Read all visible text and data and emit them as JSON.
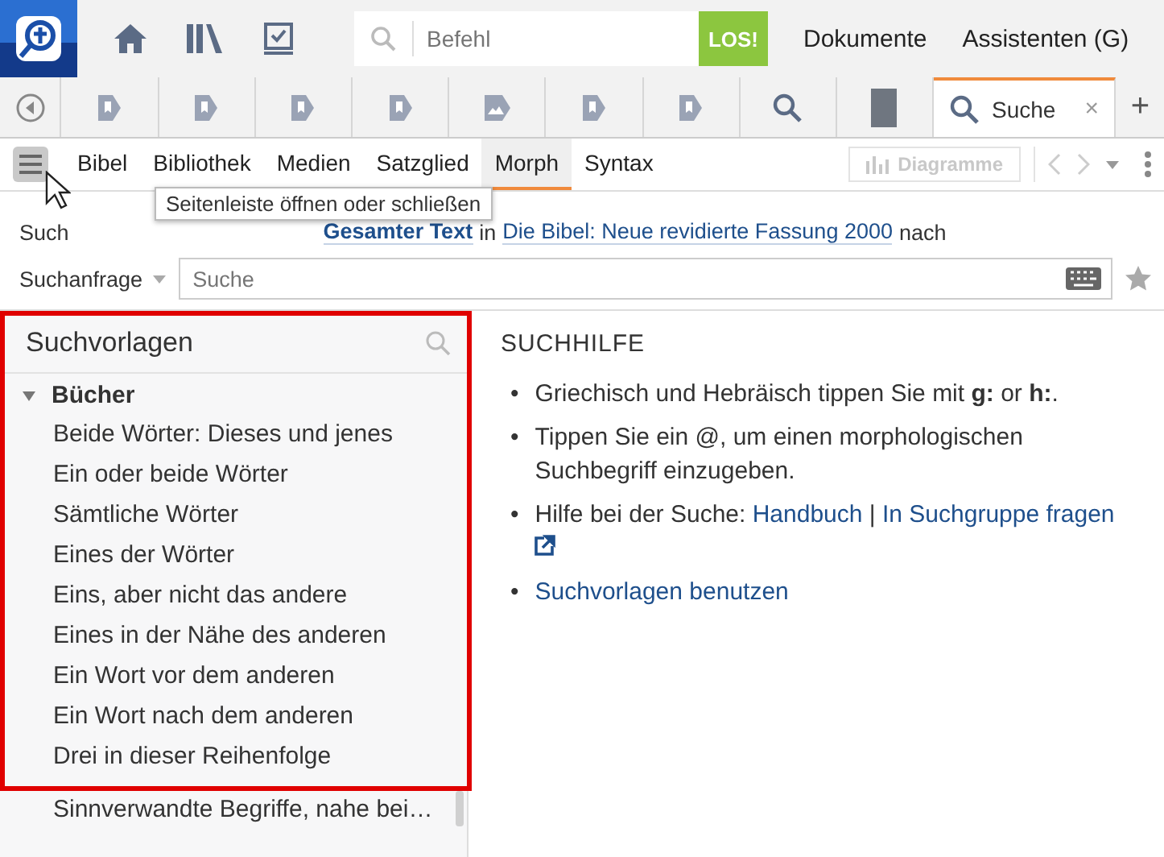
{
  "top_bar": {
    "command": {
      "placeholder": "Befehl"
    },
    "go_button": "LOS!",
    "menus": [
      "Dokumente",
      "Assistenten (G)"
    ]
  },
  "tabs": [
    {
      "kind": "doc",
      "selected": false
    },
    {
      "kind": "doc",
      "selected": false
    },
    {
      "kind": "doc",
      "selected": false
    },
    {
      "kind": "doc",
      "selected": false
    },
    {
      "kind": "image",
      "selected": false
    },
    {
      "kind": "doc",
      "selected": false
    },
    {
      "kind": "doc",
      "selected": false
    },
    {
      "kind": "search",
      "selected": false
    },
    {
      "kind": "book",
      "selected": false
    },
    {
      "kind": "search",
      "label": "Suche",
      "close": "×",
      "selected": true
    }
  ],
  "new_tab": "+",
  "toolbar": {
    "sidebar_toggle": {
      "pressed": true
    },
    "tabs": [
      {
        "label": "Bibel",
        "selected": false
      },
      {
        "label": "Bibliothek",
        "selected": false
      },
      {
        "label": "Medien",
        "selected": false
      },
      {
        "label": "Satzglied",
        "selected": false
      },
      {
        "label": "Morph",
        "selected": true
      },
      {
        "label": "Syntax",
        "selected": false
      }
    ],
    "charts_button": {
      "label": "Diagramme",
      "disabled": true
    }
  },
  "tooltip": "Seitenleiste öffnen oder schließen",
  "search_line": [
    {
      "kind": "text",
      "text": "Such"
    },
    {
      "kind": "link",
      "text": "Gesamter Text",
      "bold": true
    },
    {
      "kind": "text",
      "text": "in"
    },
    {
      "kind": "link",
      "text": "Die Bibel: Neue revidierte Fassung 2000",
      "bold": false
    },
    {
      "kind": "text",
      "text": "nach"
    }
  ],
  "query": {
    "type_label": "Suchanfrage",
    "placeholder": "Suche"
  },
  "sidebar": {
    "title": "Suchvorlagen",
    "highlighted": true,
    "tree": [
      {
        "label": "Bücher",
        "expanded": true,
        "children": [
          {
            "label": "Beide Wörter: Dieses und jenes"
          },
          {
            "label": "Ein oder beide Wörter"
          },
          {
            "label": "Sämtliche Wörter"
          },
          {
            "label": "Eines der Wörter"
          },
          {
            "label": "Eins, aber nicht das andere"
          },
          {
            "label": "Eines in der Nähe des anderen"
          },
          {
            "label": "Ein Wort vor dem anderen"
          },
          {
            "label": "Ein Wort nach dem anderen"
          },
          {
            "label": "Drei in dieser Reihenfolge"
          },
          {
            "label": "Sinnverwandte Begriffe, nahe bei…"
          }
        ]
      }
    ]
  },
  "help": {
    "title": "SUCHHILFE",
    "items": [
      {
        "kind": "text",
        "bullet": "•",
        "text": "Griechisch und Hebräisch tippen Sie mit **g:** or **h:**."
      },
      {
        "kind": "text",
        "bullet": "•",
        "text": "Tippen Sie ein @, um einen morphologischen Suchbegriff einzugeben."
      },
      {
        "kind": "links",
        "bullet": "•",
        "text": "Hilfe bei der Suche:",
        "links": [
          "Handbuch",
          "In Suchgruppe fragen"
        ],
        "separator": "|"
      },
      {
        "kind": "link",
        "bullet": "•",
        "text": "Suchvorlagen benutzen"
      }
    ]
  }
}
